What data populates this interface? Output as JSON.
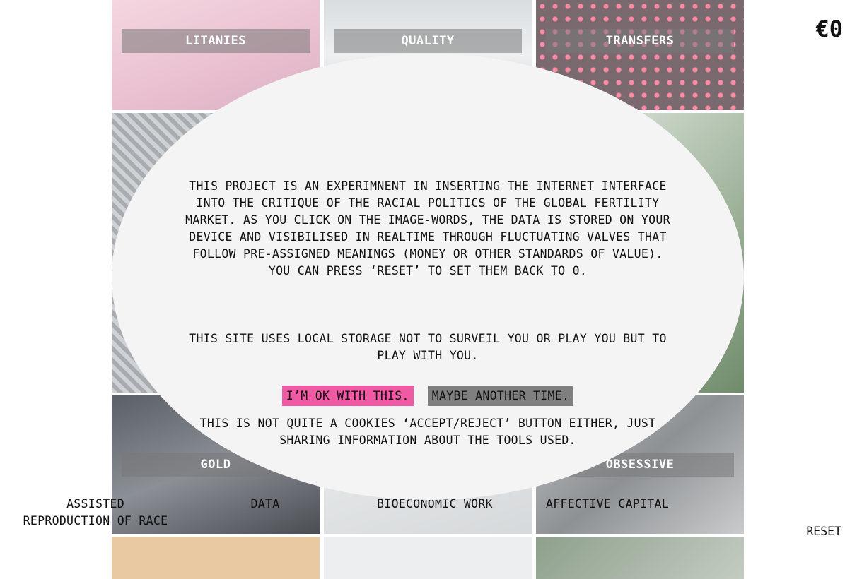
{
  "tiles": {
    "top": [
      "LITANIES",
      "QUALITY",
      "TRANSFERS"
    ],
    "middle": [
      "GOLD",
      "",
      "OBSESSIVE"
    ]
  },
  "categories": {
    "assisted": "ASSISTED\nREPRODUCTION OF RACE",
    "data": "DATA",
    "bioeconomic": "BIOECONOMIC WORK",
    "affective": "AFFECTIVE CAPITAL"
  },
  "counter": "€0",
  "reset": "RESET",
  "modal": {
    "paragraph1": "THIS PROJECT IS AN EXPERIMNENT IN INSERTING THE INTERNET INTERFACE INTO THE CRITIQUE OF THE RACIAL POLITICS OF THE GLOBAL FERTILITY MARKET. AS YOU CLICK ON THE IMAGE-WORDS, THE DATA IS STORED ON YOUR DEVICE AND VISIBILISED IN REALTIME THROUGH FLUCTUATING VALVES THAT FOLLOW PRE-ASSIGNED MEANINGS (MONEY OR OTHER STANDARDS OF VALUE). YOU CAN PRESS ‘RESET’ TO SET THEM BACK TO 0.",
    "paragraph2": "THIS SITE USES LOCAL STORAGE NOT TO SURVEIL YOU OR PLAY YOU BUT TO PLAY WITH YOU.",
    "paragraph3": "THIS IS NOT QUITE A COOKIES ‘ACCEPT/REJECT’ BUTTON EITHER, JUST SHARING INFORMATION ABOUT THE TOOLS USED.",
    "accept_label": "I’M OK WITH THIS.",
    "decline_label": "MAYBE ANOTHER TIME."
  },
  "colors": {
    "accept": "#ee5aa4",
    "decline": "#7f7f7f",
    "modal_bg": "#f4f4f4"
  }
}
